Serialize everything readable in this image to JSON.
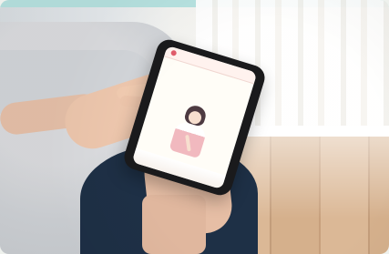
{
  "scene": {
    "photo_subject": "smartphone-in-hands",
    "device": "smartphone",
    "screen_brand": "",
    "screen_title": "",
    "screen_subtitle": ""
  },
  "colors": {
    "top_accent": "#b7e3e1",
    "phone": "#1a1a1c",
    "screen_background": "#fffdf7",
    "brand_color": "#c33d4c",
    "clothing": "#1e3046"
  }
}
